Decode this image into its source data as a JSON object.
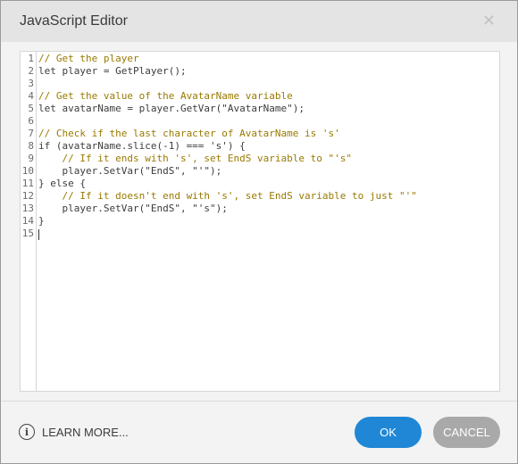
{
  "dialog": {
    "title": "JavaScript Editor",
    "close_glyph": "✕"
  },
  "editor": {
    "lines": [
      {
        "num": "1",
        "text": "// Get the player",
        "kind": "comment"
      },
      {
        "num": "2",
        "text": "let player = GetPlayer();",
        "kind": "code"
      },
      {
        "num": "3",
        "text": "",
        "kind": "code"
      },
      {
        "num": "4",
        "text": "// Get the value of the AvatarName variable",
        "kind": "comment"
      },
      {
        "num": "5",
        "text": "let avatarName = player.GetVar(\"AvatarName\");",
        "kind": "code"
      },
      {
        "num": "6",
        "text": "",
        "kind": "code"
      },
      {
        "num": "7",
        "text": "// Check if the last character of AvatarName is 's'",
        "kind": "comment"
      },
      {
        "num": "8",
        "text": "if (avatarName.slice(-1) === 's') {",
        "kind": "code"
      },
      {
        "num": "9",
        "text": "    // If it ends with 's', set EndS variable to \"'s\"",
        "kind": "comment"
      },
      {
        "num": "10",
        "text": "    player.SetVar(\"EndS\", \"'\");",
        "kind": "code"
      },
      {
        "num": "11",
        "text": "} else {",
        "kind": "code"
      },
      {
        "num": "12",
        "text": "    // If it doesn't end with 's', set EndS variable to just \"'\"",
        "kind": "comment"
      },
      {
        "num": "13",
        "text": "    player.SetVar(\"EndS\", \"'s\");",
        "kind": "code"
      },
      {
        "num": "14",
        "text": "}",
        "kind": "code"
      },
      {
        "num": "15",
        "text": "",
        "kind": "code"
      }
    ]
  },
  "footer": {
    "learn_more_label": "LEARN MORE...",
    "info_glyph": "i",
    "ok_label": "OK",
    "cancel_label": "CANCEL"
  },
  "colors": {
    "accent": "#1f87d6",
    "cancel": "#a9a9a9",
    "comment": "#9a7a00"
  },
  "icons": [
    "close-icon",
    "info-icon"
  ]
}
